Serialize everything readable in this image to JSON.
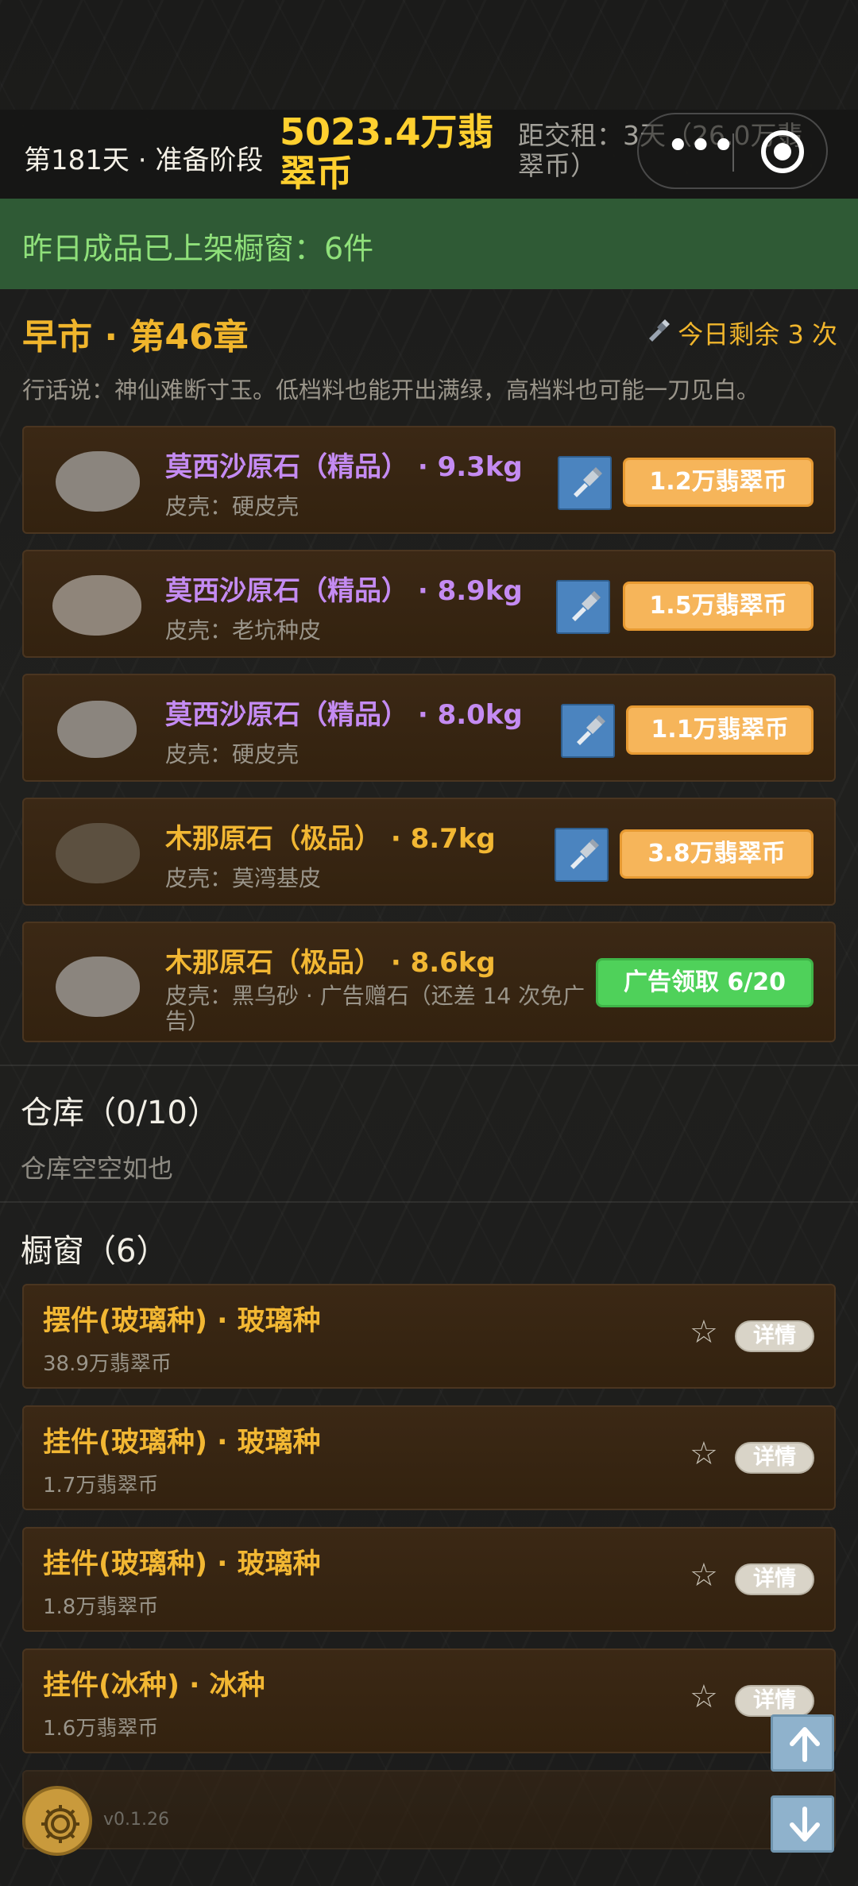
{
  "status": {
    "day_stage": "第181天 · 准备阶段",
    "money": "5023.4万翡翠币",
    "rent_due": "距交租：3天（26.0万翡翠币）"
  },
  "banner": {
    "text": "昨日成品已上架橱窗：6件"
  },
  "market": {
    "title": "早市 · 第46章",
    "remaining": "今日剩余 3 次",
    "saying": "行话说：神仙难断寸玉。低档料也能开出满绿，高档料也可能一刀见白。"
  },
  "stones": [
    {
      "name": "莫西沙原石（精品） · 9.3kg",
      "shell": "皮壳：硬皮壳",
      "action": "1.2万翡翠币",
      "name_color": "#c48bf2",
      "stone_color": "#8b857e"
    },
    {
      "name": "莫西沙原石（精品） · 8.9kg",
      "shell": "皮壳：老坑种皮",
      "action": "1.5万翡翠币",
      "name_color": "#c48bf2",
      "stone_color": "#8f857a"
    },
    {
      "name": "莫西沙原石（精品） · 8.0kg",
      "shell": "皮壳：硬皮壳",
      "action": "1.1万翡翠币",
      "name_color": "#c48bf2",
      "stone_color": "#8b857e"
    },
    {
      "name": "木那原石（极品） · 8.7kg",
      "shell": "皮壳：莫湾基皮",
      "action": "3.8万翡翠币",
      "name_color": "#f2b733",
      "stone_color": "#5c5040"
    },
    {
      "name": "木那原石（极品） · 8.6kg",
      "shell": "皮壳：黑乌砂 · 广告赠石（还差 14 次免广告）",
      "action": "广告领取 6/20",
      "name_color": "#f2b733",
      "stone_color": "#8b857e"
    }
  ],
  "warehouse": {
    "title": "仓库（0/10）",
    "empty_text": "仓库空空如也"
  },
  "showcase": {
    "title": "橱窗（6）",
    "detail_label": "详情",
    "items": [
      {
        "name": "摆件(玻璃种) · 玻璃种",
        "price": "38.9万翡翠币"
      },
      {
        "name": "挂件(玻璃种) · 玻璃种",
        "price": "1.7万翡翠币"
      },
      {
        "name": "挂件(玻璃种) · 玻璃种",
        "price": "1.8万翡翠币"
      },
      {
        "name": "挂件(冰种) · 冰种",
        "price": "1.6万翡翠币"
      }
    ]
  },
  "footer": {
    "version": "v0.1.26"
  },
  "icons": {
    "flashlight": "flashlight-icon",
    "star": "star-icon",
    "settings": "gear-icon",
    "scroll_up": "arrow-up-icon",
    "scroll_down": "arrow-down-icon",
    "more": "more-dots-icon",
    "close": "target-circle-icon"
  },
  "colors": {
    "gold": "#f0b52c",
    "purple": "#c48bf2",
    "price_button": "#f6b55a",
    "ad_button": "#4fd15a",
    "banner_bg": "#2f5a35",
    "banner_text": "#8fe07a",
    "card_bg": "#3b2815"
  }
}
